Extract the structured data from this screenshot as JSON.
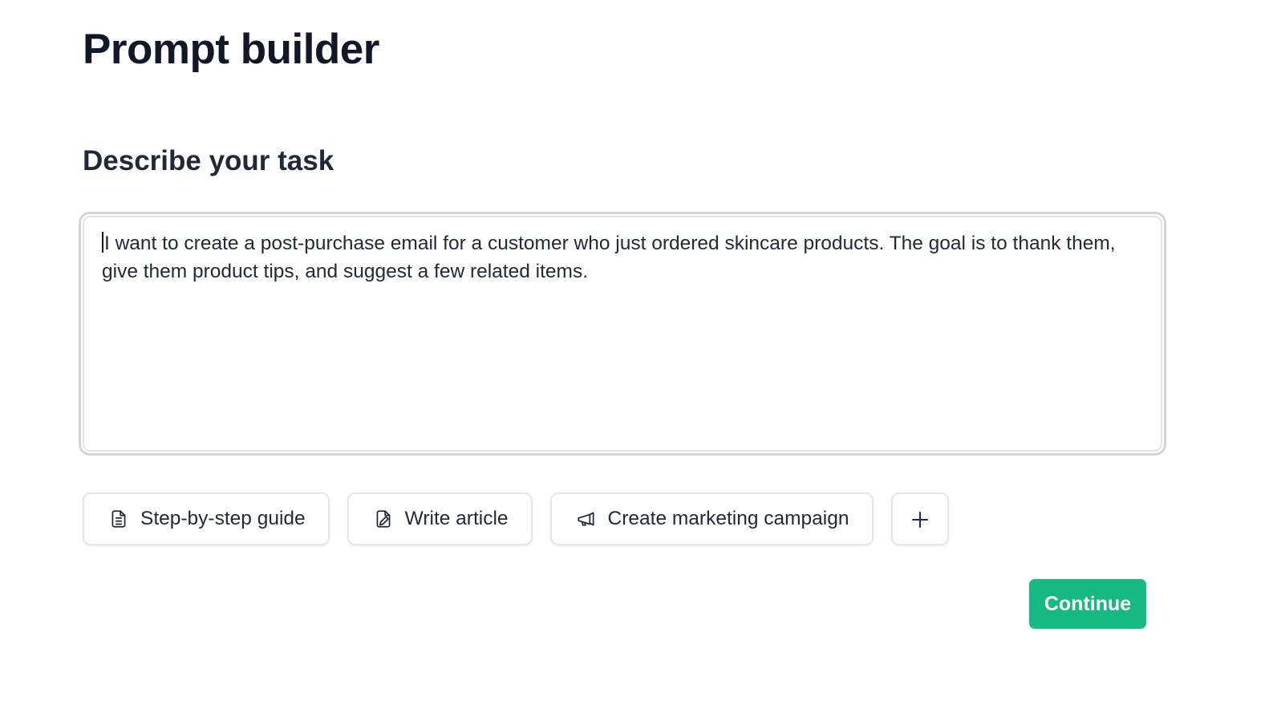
{
  "page": {
    "title": "Prompt builder"
  },
  "task": {
    "heading": "Describe your task",
    "text": "I want to create a post-purchase email for a customer who just ordered skincare products. The goal is to thank them, give them product tips, and suggest a few related items."
  },
  "chips": [
    {
      "label": "Step-by-step guide",
      "icon": "document-icon"
    },
    {
      "label": "Write article",
      "icon": "edit-document-icon"
    },
    {
      "label": "Create marketing campaign",
      "icon": "megaphone-icon"
    },
    {
      "label": "",
      "icon": "plus-icon"
    }
  ],
  "actions": {
    "continue_label": "Continue"
  },
  "colors": {
    "accent": "#16b981",
    "text": "#111827",
    "border": "#d4d4d4"
  }
}
